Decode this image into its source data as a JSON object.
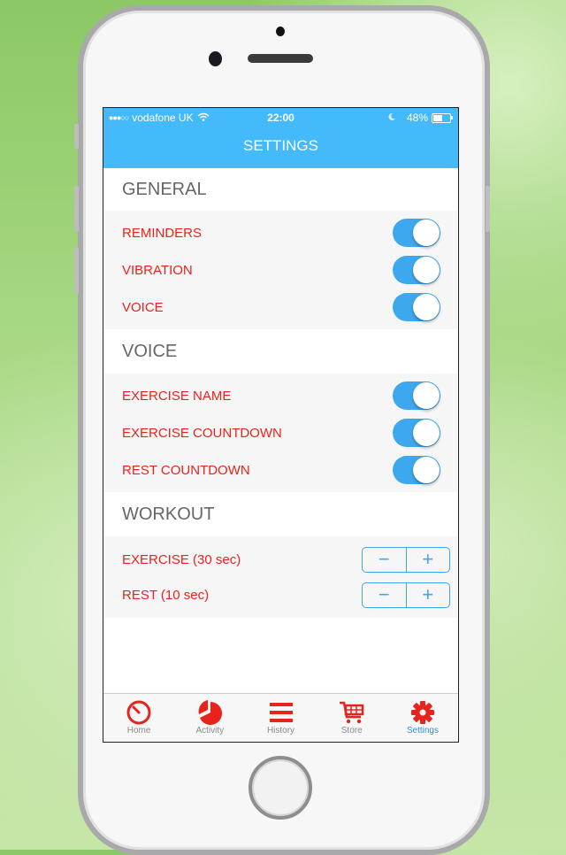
{
  "status_bar": {
    "signal": "●●●○○",
    "carrier": "vodafone UK",
    "time": "22:00",
    "battery_percent": "48%"
  },
  "nav": {
    "title": "SETTINGS"
  },
  "sections": [
    {
      "title": "GENERAL",
      "rows": [
        {
          "label": "REMINDERS",
          "on": true
        },
        {
          "label": "VIBRATION",
          "on": true
        },
        {
          "label": "VOICE",
          "on": true
        }
      ]
    },
    {
      "title": "VOICE",
      "rows": [
        {
          "label": "EXERCISE NAME",
          "on": true
        },
        {
          "label": "EXERCISE COUNTDOWN",
          "on": true
        },
        {
          "label": "REST COUNTDOWN",
          "on": true
        }
      ]
    },
    {
      "title": "WORKOUT",
      "rows": [
        {
          "label": "EXERCISE (30 sec)",
          "minus": "−",
          "plus": "+"
        },
        {
          "label": "REST (10 sec)",
          "minus": "−",
          "plus": "+"
        }
      ]
    }
  ],
  "tabs": [
    {
      "label": "Home",
      "icon": "stopwatch-icon"
    },
    {
      "label": "Activity",
      "icon": "pie-chart-icon"
    },
    {
      "label": "History",
      "icon": "list-icon"
    },
    {
      "label": "Store",
      "icon": "cart-icon"
    },
    {
      "label": "Settings",
      "icon": "gear-icon",
      "active": true
    }
  ],
  "colors": {
    "accent": "#44bafa",
    "toggle": "#3ea8ee",
    "label_red": "#e8231b",
    "tab_active": "#2f8fe0"
  }
}
